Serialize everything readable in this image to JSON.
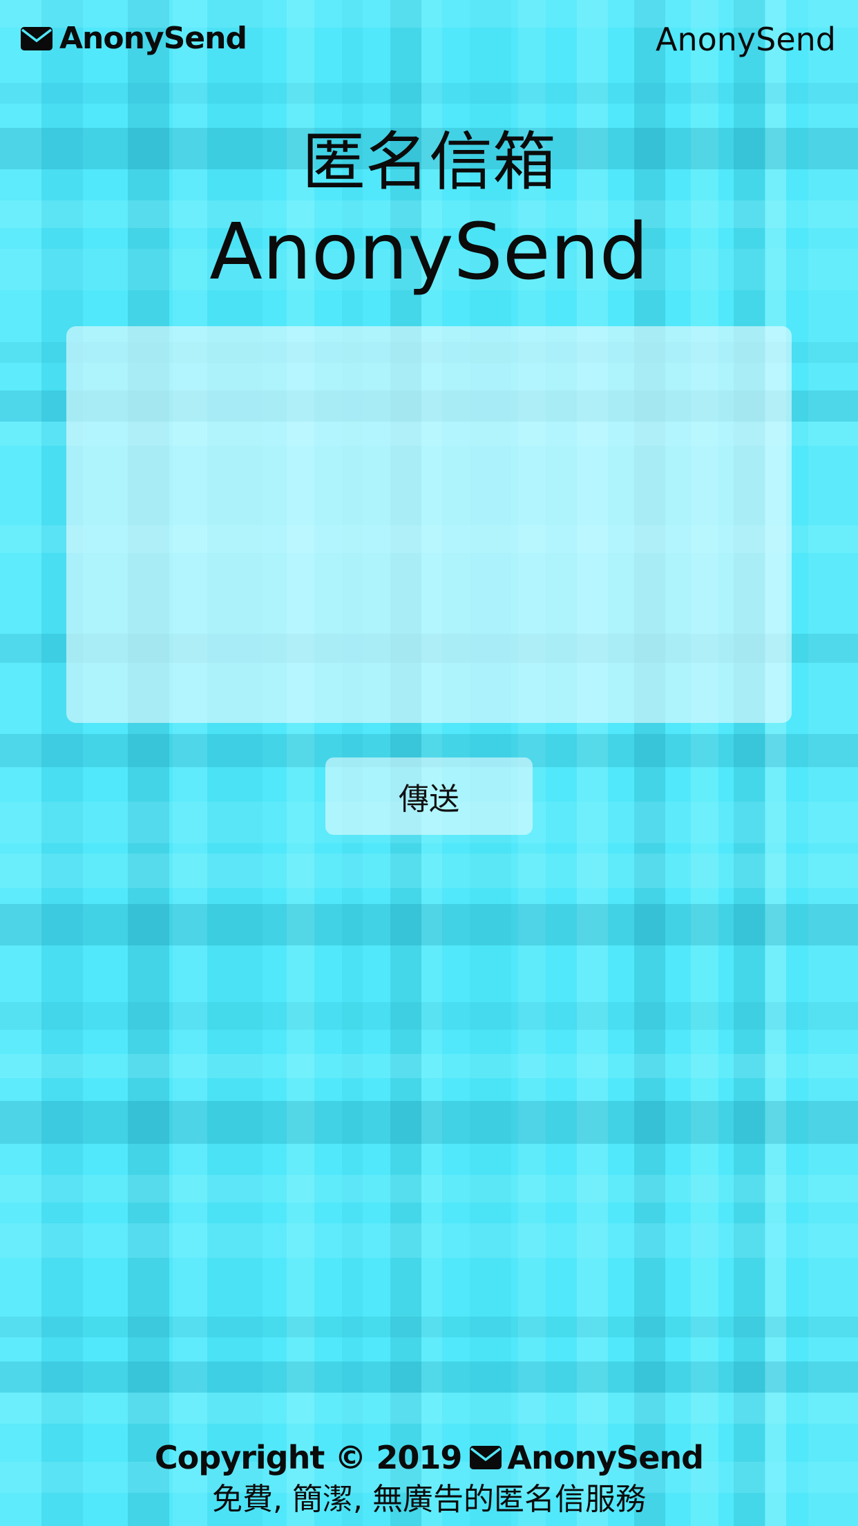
{
  "header": {
    "brand_icon": "envelope-icon",
    "brand_label": "AnonySend",
    "nav_link_label": "AnonySend"
  },
  "hero": {
    "title_zh": "匿名信箱",
    "title_en": "AnonySend"
  },
  "form": {
    "message_value": "",
    "send_label": "傳送"
  },
  "footer": {
    "copyright_prefix": "Copyright © 2019",
    "copyright_icon": "envelope-icon",
    "copyright_brand": "AnonySend",
    "tagline": "免費, 簡潔, 無廣告的匿名信服務"
  },
  "colors": {
    "background": "#50e8fa",
    "text": "#0b0b0b",
    "panel": "#e6fcff"
  }
}
